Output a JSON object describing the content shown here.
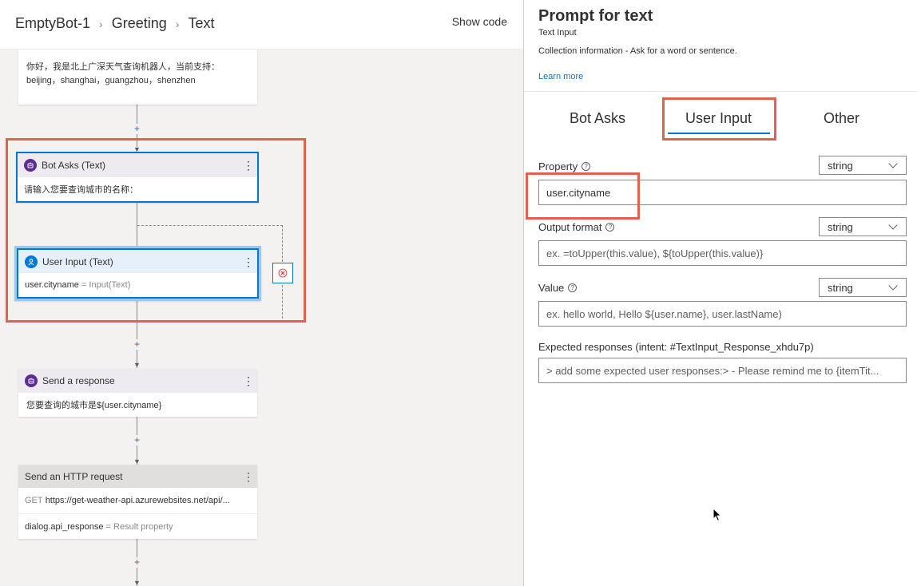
{
  "breadcrumb": {
    "items": [
      "EmptyBot-1",
      "Greeting",
      "Text"
    ],
    "separator": "›"
  },
  "header": {
    "show_code": "Show code"
  },
  "canvas": {
    "greeting_card": {
      "line1": "你好，我是北上广深天气查询机器人，当前支持：",
      "line2": "beijing，shanghai，guangzhou，shenzhen"
    },
    "bot_asks": {
      "title": "Bot Asks (Text)",
      "body": "请输入您要查询城市的名称："
    },
    "user_input": {
      "title": "User Input (Text)",
      "property": "user.cityname",
      "suffix": "= Input(Text)"
    },
    "send_response": {
      "title": "Send a response",
      "body": "您要查询的城市是${user.cityname}"
    },
    "http_request": {
      "title": "Send an HTTP request",
      "method": "GET",
      "url": "https://get-weather-api.azurewebsites.net/api/...",
      "result_var": "dialog.api_response",
      "result_suffix": "= Result property"
    },
    "plus": "+",
    "more": "⋮"
  },
  "panel": {
    "title": "Prompt for text",
    "subtitle": "Text Input",
    "description": "Collection information - Ask for a word or sentence.",
    "learn_more": "Learn more",
    "tabs": [
      {
        "label": "Bot Asks",
        "selected": false
      },
      {
        "label": "User Input",
        "selected": true
      },
      {
        "label": "Other",
        "selected": false
      }
    ],
    "fields": {
      "property": {
        "label": "Property",
        "type": "string",
        "value": "user.cityname"
      },
      "output_format": {
        "label": "Output format",
        "type": "string",
        "placeholder": "ex. =toUpper(this.value), ${toUpper(this.value)}"
      },
      "value": {
        "label": "Value",
        "type": "string",
        "placeholder": "ex. hello world, Hello ${user.name}, user.lastName)"
      },
      "expected": {
        "label": "Expected responses (intent: #TextInput_Response_xhdu7p)",
        "placeholder": "> add some expected user responses:> - Please remind me to {itemTit..."
      }
    },
    "help_glyph": "?"
  },
  "colors": {
    "accent": "#0078d4",
    "highlight": "#e4604f",
    "bot_icon": "#5c2d91",
    "user_icon": "#0078d4"
  }
}
